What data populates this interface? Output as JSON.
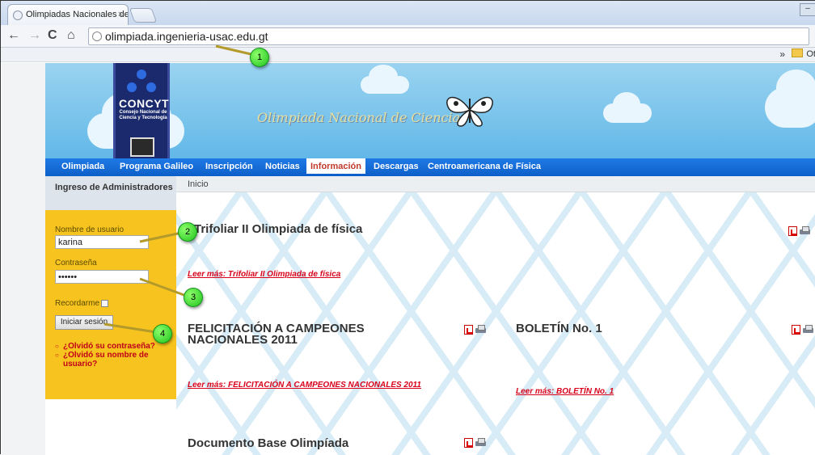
{
  "browser": {
    "tab_title": "Olimpiadas Nacionales de C",
    "tab_close": "×",
    "url": "olimpiada.ingenieria-usac.edu.gt",
    "bookmarks_more": "»",
    "bookmarks_folder": "Ot"
  },
  "banner": {
    "logo_brand": "CONCYT",
    "logo_subtitle": "Consejo Nacional de Ciencia y Tecnología",
    "title": "Olimpiada Nacional de Ciencias"
  },
  "menu": {
    "items": [
      "Olimpiada",
      "Programa Galileo",
      "Inscripción",
      "Noticias",
      "Información",
      "Descargas",
      "Centroamericana de Física"
    ],
    "active": "Información"
  },
  "sidebar": {
    "heading": "Ingreso de Administradores",
    "username_label": "Nombre de usuario",
    "username_value": "karina",
    "password_label": "Contraseña",
    "password_value": "••••••",
    "remember_label": "Recordarme",
    "login_button": "Iniciar sesión",
    "links": [
      "¿Olvidó su contraseña?",
      "¿Olvidó su nombre de usuario?"
    ]
  },
  "breadcrumb": "Inicio",
  "articles": [
    {
      "title": "Trifoliar II Olimpiada de física",
      "readmore": "Leer más: Trifoliar II Olimpiada de física"
    },
    {
      "title": "FELICITACIÓN A CAMPEONES NACIONALES 2011",
      "readmore": "Leer más: FELICITACIÓN A CAMPEONES NACIONALES 2011"
    },
    {
      "title": "BOLETÍN No. 1",
      "readmore": "Leer más: BOLETÍN No. 1"
    },
    {
      "title": "Documento Base Olimpíada",
      "readmore": ""
    }
  ],
  "callouts": [
    "1",
    "2",
    "3",
    "4"
  ],
  "colors": {
    "menu_blue": "#1f7ae6",
    "login_yellow": "#f7c41f",
    "link_red": "#d8001a",
    "callout_green": "#1ec21e"
  }
}
